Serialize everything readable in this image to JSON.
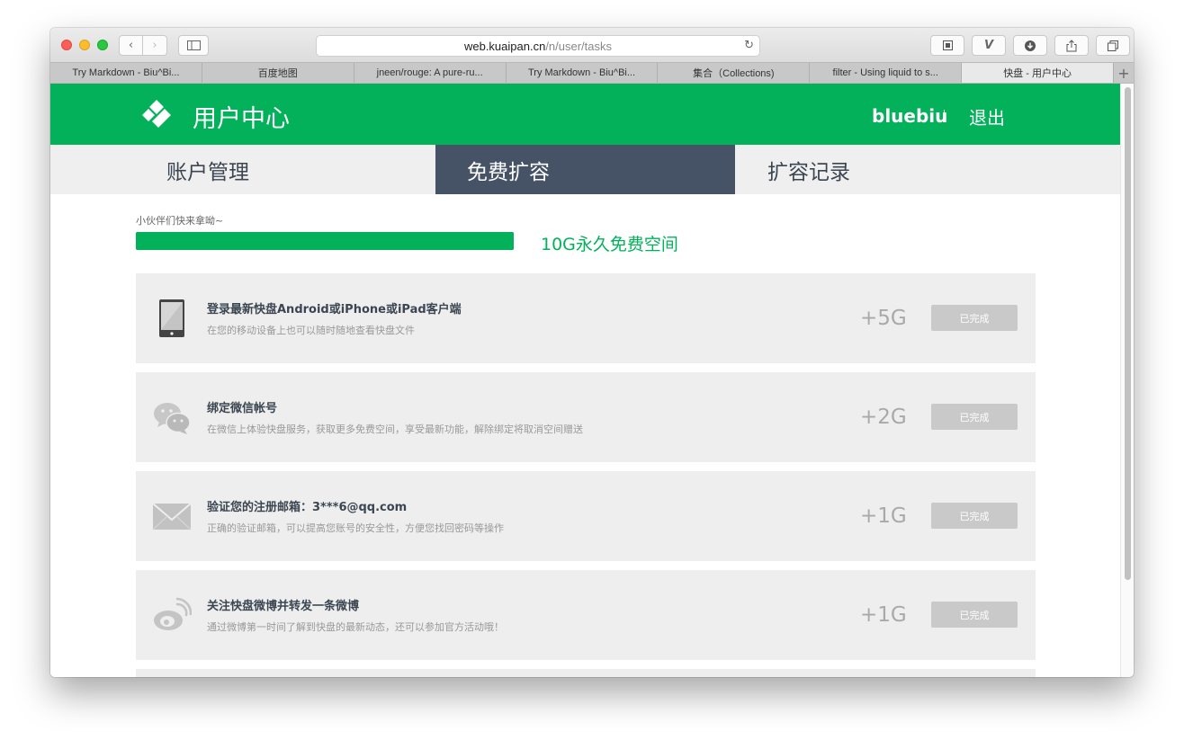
{
  "browser": {
    "url_host": "web.kuaipan.cn",
    "url_path": "/n/user/tasks",
    "tabs": [
      {
        "label": "Try Markdown - Biu^Bi..."
      },
      {
        "label": "百度地图"
      },
      {
        "label": "jneen/rouge: A pure-ru..."
      },
      {
        "label": "Try Markdown - Biu^Bi..."
      },
      {
        "label": "集合（Collections)"
      },
      {
        "label": "filter - Using liquid to s..."
      },
      {
        "label": "快盘 - 用户中心"
      }
    ],
    "new_tab_glyph": "+"
  },
  "header": {
    "title": "用户中心",
    "username": "bluebiu",
    "logout_label": "退出"
  },
  "subnav": {
    "items": [
      {
        "label": "账户管理"
      },
      {
        "label": "免费扩容"
      },
      {
        "label": "扩容记录"
      }
    ],
    "active": "免费扩容"
  },
  "progress": {
    "hint": "小伙伴们快来拿呦~",
    "label": "10G永久免费空间",
    "fraction": 1.0
  },
  "tasks": [
    {
      "icon": "phone-icon",
      "title": "登录最新快盘Android或iPhone或iPad客户端",
      "desc": "在您的移动设备上也可以随时随地查看快盘文件",
      "reward": "+5G",
      "status": "已完成"
    },
    {
      "icon": "wechat-icon",
      "title": "绑定微信帐号",
      "desc": "在微信上体验快盘服务，获取更多免费空间，享受最新功能，解除绑定将取消空间赠送",
      "reward": "+2G",
      "status": "已完成"
    },
    {
      "icon": "mail-icon",
      "title": "验证您的注册邮箱：3***6@qq.com",
      "desc": "正确的验证邮箱，可以提高您账号的安全性，方便您找回密码等操作",
      "reward": "+1G",
      "status": "已完成"
    },
    {
      "icon": "weibo-icon",
      "title": "关注快盘微博并转发一条微博",
      "desc": "通过微博第一时间了解到快盘的最新动态，还可以参加官方活动哦！",
      "reward": "+1G",
      "status": "已完成"
    }
  ],
  "colors": {
    "brand_green": "#03b15a",
    "nav_active": "#465366",
    "task_bg": "#eeeeee"
  }
}
